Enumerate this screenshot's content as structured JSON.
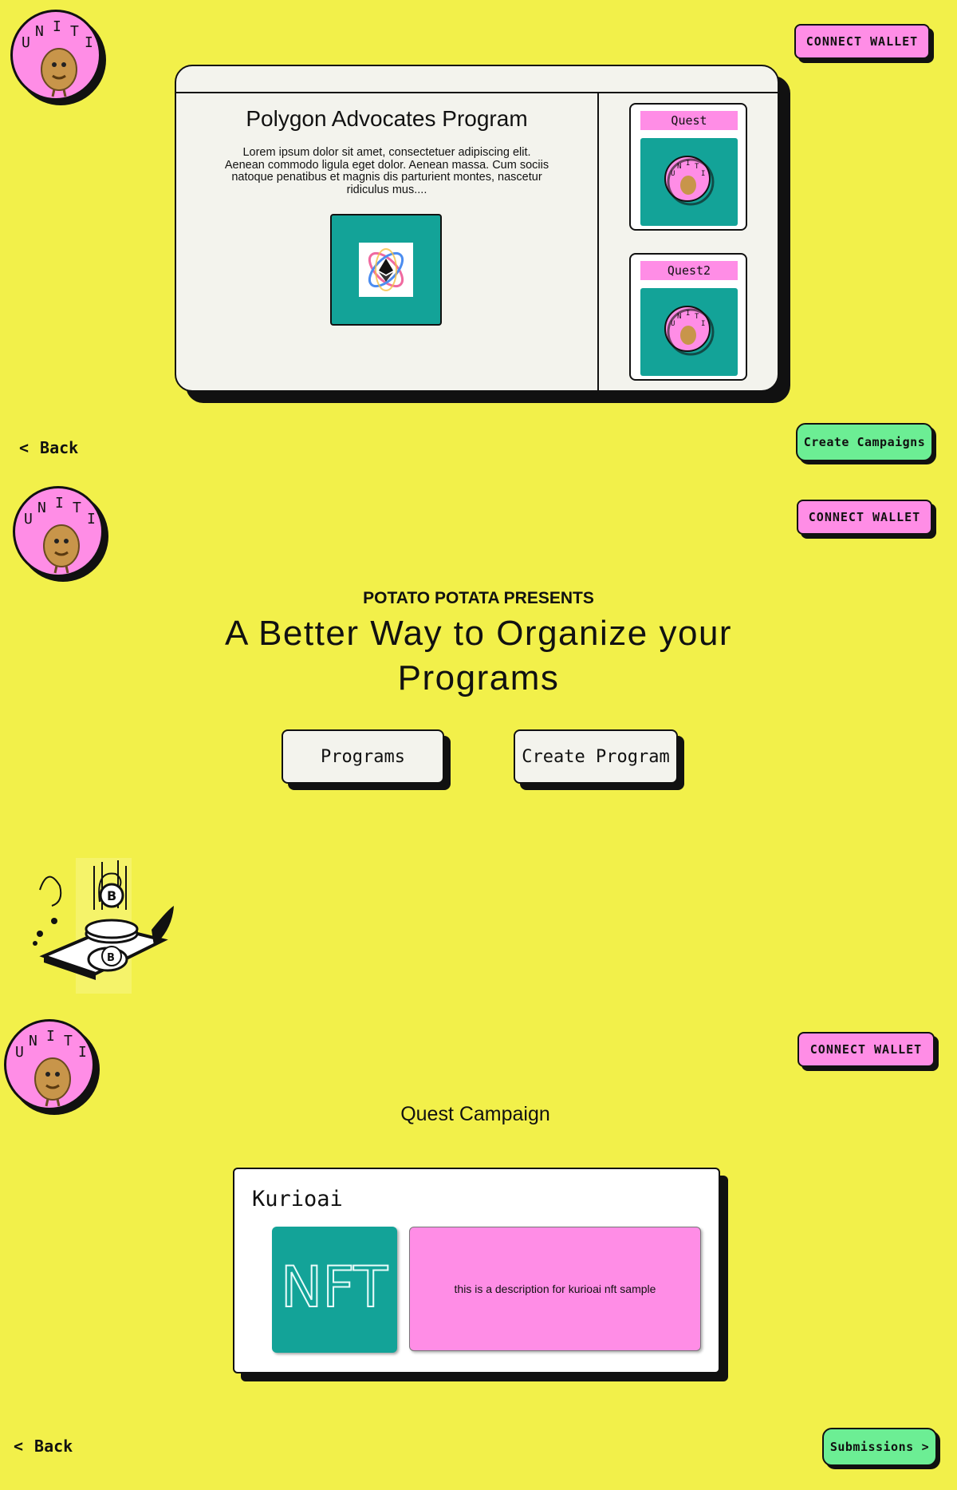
{
  "logo": {
    "letters": [
      "U",
      "N",
      "I",
      "T",
      "I"
    ]
  },
  "header": {
    "connect_label": "CONNECT WALLET"
  },
  "program_card": {
    "title": "Polygon Advocates Program",
    "description": "Lorem ipsum dolor sit amet, consectetuer adipiscing elit. Aenean commodo ligula eget dolor. Aenean massa. Cum sociis natoque penatibus et magnis dis parturient montes, nascetur ridiculus mus....",
    "quests": [
      {
        "label": "Quest"
      },
      {
        "label": "Quest2"
      }
    ]
  },
  "nav": {
    "back_label": "Back",
    "create_campaigns_label": "Create Campaigns",
    "submissions_label": "Submissions"
  },
  "hero": {
    "eyebrow": "POTATO POTATA PRESENTS",
    "headline": "A Better Way to Organize your Programs",
    "programs_label": "Programs",
    "create_program_label": "Create Program"
  },
  "campaign": {
    "heading": "Quest Campaign",
    "name": "Kurioai",
    "nft_text": "NFT",
    "description": "this is a description for kurioai nft sample"
  },
  "colors": {
    "background": "#f2f04a",
    "pink": "#ff8de6",
    "teal": "#13a398",
    "green": "#6cee94",
    "ink": "#111111"
  },
  "icons": {
    "back": "chevron-left-icon",
    "forward": "chevron-right-icon",
    "program_token": "ethereum-orbit-icon",
    "illustration": "crypto-coins-phone-illustration"
  }
}
